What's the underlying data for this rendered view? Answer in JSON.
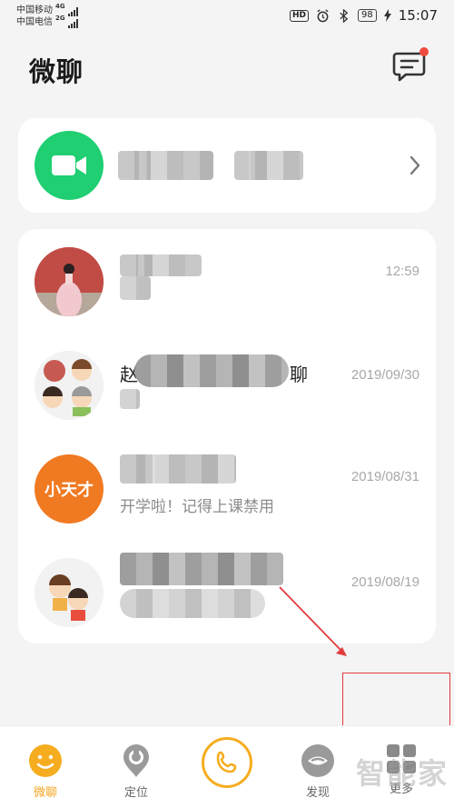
{
  "status_bar": {
    "carrier_1": "中国移动",
    "carrier_1_network": "4G",
    "carrier_2": "中国电信",
    "carrier_2_network": "2G",
    "hd_badge": "HD",
    "battery": "98",
    "time": "15:07"
  },
  "header": {
    "title": "微聊",
    "message_icon": "message-icon",
    "has_notification_dot": true
  },
  "video_call_card": {
    "icon": "video-camera-icon",
    "icon_bg_color": "#1fcf72"
  },
  "chats": [
    {
      "avatar": "avatar-photo-woman-pink-dress",
      "name": "",
      "time": "12:59",
      "preview": ""
    },
    {
      "avatar": "avatar-group-family",
      "name_prefix": "赵",
      "name_suffix": "聊",
      "time": "2019/09/30",
      "preview": ""
    },
    {
      "avatar": "avatar-xiaotiancai-logo",
      "avatar_text": "小天才",
      "name": "",
      "time": "2019/08/31",
      "preview": "开学啦！记得上课禁用"
    },
    {
      "avatar": "avatar-cartoon-couple",
      "name": "",
      "time": "2019/08/19",
      "preview": ""
    }
  ],
  "bottom_nav": [
    {
      "label": "微聊",
      "icon": "smiley-chat-icon",
      "active": true
    },
    {
      "label": "定位",
      "icon": "location-icon",
      "active": false
    },
    {
      "label": "",
      "icon": "phone-call-icon",
      "active": false
    },
    {
      "label": "发现",
      "icon": "discover-icon",
      "active": false
    },
    {
      "label": "更多",
      "icon": "more-grid-icon",
      "active": false
    }
  ],
  "watermark": "智能家",
  "colors": {
    "accent": "#f5ad1f",
    "video_green": "#1fcf72",
    "notification_red": "#f04a3e",
    "annotation_red": "#e23a3a"
  }
}
